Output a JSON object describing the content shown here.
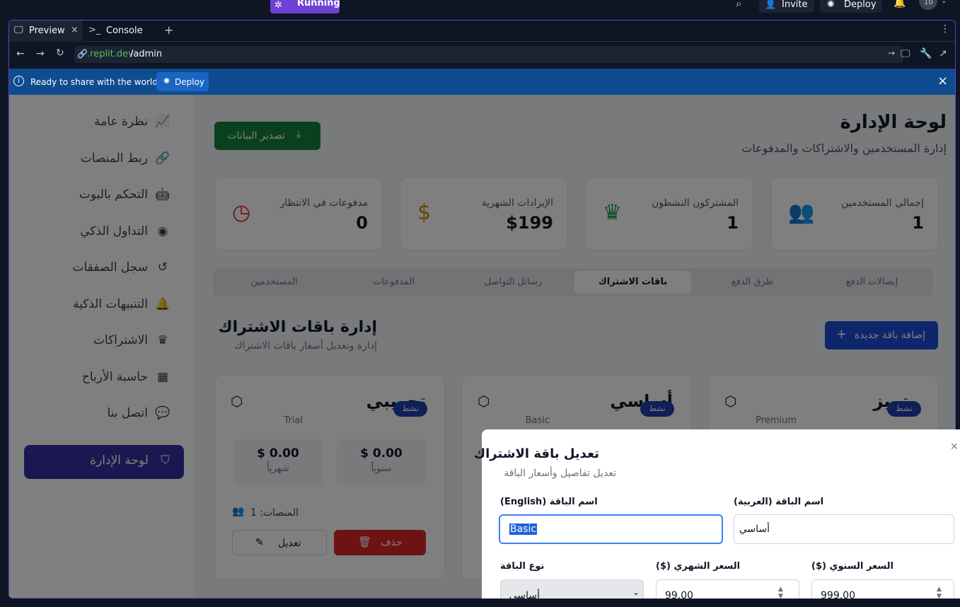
{
  "top": {
    "running": "Running",
    "invite": "Invite",
    "deploy": "Deploy",
    "notif_count": "10"
  },
  "pane_tabs": [
    {
      "label": "Preview"
    },
    {
      "label": "Console"
    }
  ],
  "url": {
    "domain": ".replit.dev",
    "path": "/admin"
  },
  "banner": {
    "text": "Ready to share with the world?",
    "deploy": "Deploy"
  },
  "sidebar": {
    "items": [
      {
        "label": "نظرة عامة",
        "icon": "chart-icon"
      },
      {
        "label": "ربط المنصات",
        "icon": "link-icon"
      },
      {
        "label": "التحكم بالبوت",
        "icon": "bot-icon"
      },
      {
        "label": "التداول الذكي",
        "icon": "brain-icon"
      },
      {
        "label": "سجل الصفقات",
        "icon": "history-icon"
      },
      {
        "label": "التنبيهات الذكية",
        "icon": "bell-icon"
      },
      {
        "label": "الاشتراكات",
        "icon": "crown-icon"
      },
      {
        "label": "حاسبة الأرباح",
        "icon": "calculator-icon"
      },
      {
        "label": "اتصل بنا",
        "icon": "chat-icon"
      }
    ],
    "admin": "لوحة الإدارة"
  },
  "header": {
    "title": "لوحة الإدارة",
    "subtitle": "إدارة المستخدمين والاشتراكات والمدفوعات",
    "export": "تصدير البيانات"
  },
  "stats": [
    {
      "label": "إجمالي المستخدمين",
      "value": "1",
      "color": "#2563eb"
    },
    {
      "label": "المشتركون النشطون",
      "value": "1",
      "color": "#16a34a"
    },
    {
      "label": "الإيرادات الشهرية",
      "value": "$199",
      "color": "#ca8a04"
    },
    {
      "label": "مدفوعات في الانتظار",
      "value": "0",
      "color": "#dc2626"
    }
  ],
  "tabs": [
    "إيصالات الدفع",
    "طرق الدفع",
    "باقات الاشتراك",
    "رسائل التواصل",
    "المدفوعات",
    "المستخدمين"
  ],
  "section": {
    "title": "إدارة باقات الاشتراك",
    "subtitle": "إدارة وتعديل أسعار باقات الاشتراك",
    "add": "إضافة باقة جديدة"
  },
  "plans": [
    {
      "ar": "تجريبي",
      "en": "Trial",
      "badge": "نشط",
      "yearly": "$ 0.00",
      "monthly": "$ 0.00",
      "yearly_lbl": "سنوياً",
      "monthly_lbl": "شهرياً",
      "platforms": "المنصات: 1",
      "edit": "تعديل",
      "delete": "حذف"
    },
    {
      "ar": "أساسي",
      "en": "Basic",
      "badge": "نشط"
    },
    {
      "ar": "متميز",
      "en": "Premium",
      "badge": "نشط"
    }
  ],
  "modal": {
    "title": "تعديل باقة الاشتراك",
    "subtitle": "تعديل تفاصيل وأسعار الباقة",
    "name_ar_lbl": "اسم الباقة (العربية)",
    "name_ar": "أساسي",
    "name_en_lbl": "اسم الباقة (English)",
    "name_en": "Basic",
    "yearly_lbl": "السعر السنوي ($)",
    "yearly": "999.00",
    "monthly_lbl": "السعر الشهري ($)",
    "monthly": "99.00",
    "type_lbl": "نوع الباقة",
    "type": "أساسي"
  }
}
